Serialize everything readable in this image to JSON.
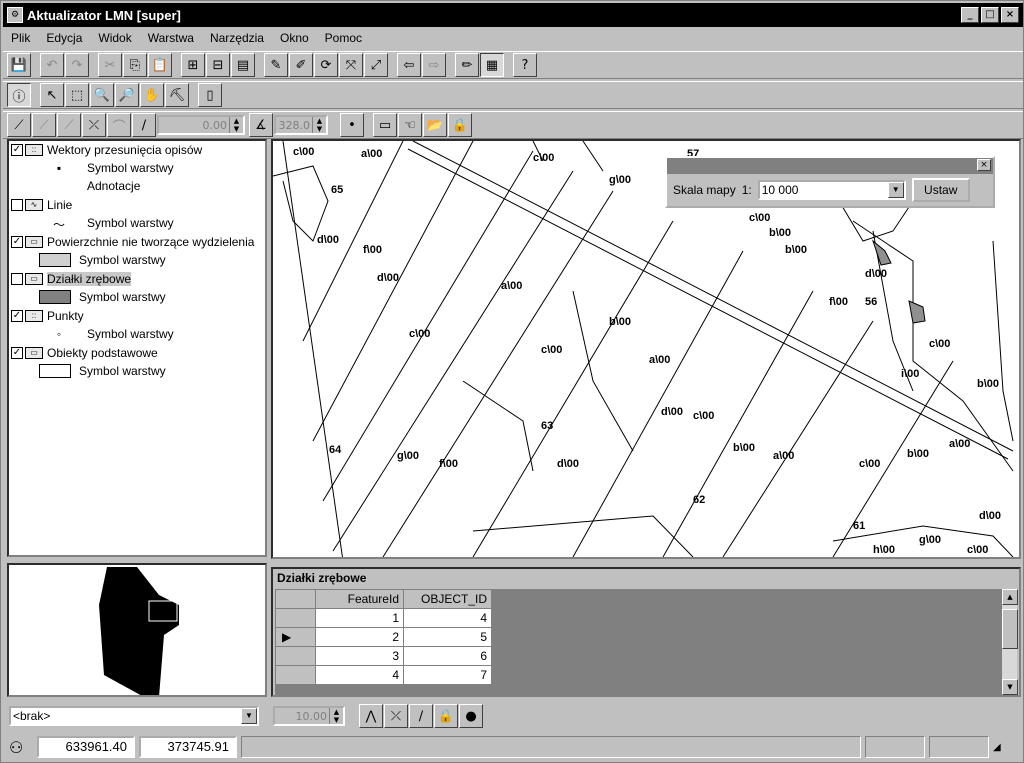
{
  "window": {
    "title": "Aktualizator LMN [super]",
    "minimize": "_",
    "maximize": "□",
    "close": "×"
  },
  "menu": [
    "Plik",
    "Edycja",
    "Widok",
    "Warstwa",
    "Narzędzia",
    "Okno",
    "Pomoc"
  ],
  "toolbar3": {
    "angle_value": "0.00",
    "length_value": "328.0"
  },
  "legend": {
    "layers": [
      {
        "name": "Wektory przesunięcia opisów",
        "checked": true,
        "sub": [
          "Symbol warstwy",
          "Adnotacje"
        ]
      },
      {
        "name": "Linie",
        "checked": false,
        "sub": [
          "Symbol warstwy"
        ]
      },
      {
        "name": "Powierzchnie nie tworzące wydzielenia",
        "checked": true,
        "sub": [
          "Symbol warstwy"
        ]
      },
      {
        "name": "Działki zrębowe",
        "checked": false,
        "sub": [
          "Symbol warstwy"
        ]
      },
      {
        "name": "Punkty",
        "checked": true,
        "sub": [
          "Symbol warstwy"
        ]
      },
      {
        "name": "Obiekty podstawowe",
        "checked": true,
        "sub": [
          "Symbol warstwy"
        ]
      }
    ]
  },
  "map": {
    "labels": [
      "c\\00",
      "a\\00",
      "c\\00",
      "g\\00",
      "57",
      "65",
      "d\\00",
      "f\\00",
      "d\\00",
      "a\\00",
      "c\\00",
      "b\\00",
      "b\\00",
      "c\\00",
      "d\\00",
      "56",
      "f\\00",
      "c\\00",
      "b\\00",
      "c\\00",
      "a\\00",
      "63",
      "d\\00",
      "c\\00",
      "i\\00",
      "64",
      "g\\00",
      "f\\00",
      "d\\00",
      "b\\00",
      "a\\00",
      "c\\00",
      "b\\00",
      "a\\00",
      "62",
      "61",
      "g\\00",
      "h\\00",
      "d\\00",
      "c\\00",
      "b\\00"
    ]
  },
  "scale_window": {
    "label": "Skala mapy",
    "prefix": "1:",
    "value": "10 000",
    "button": "Ustaw"
  },
  "table": {
    "title": "Działki zrębowe",
    "columns": [
      "FeatureId",
      "OBJECT_ID"
    ],
    "rows": [
      [
        "1",
        "4"
      ],
      [
        "2",
        "5"
      ],
      [
        "3",
        "6"
      ],
      [
        "4",
        "7"
      ]
    ]
  },
  "bottom": {
    "combo_value": "<brak>",
    "spin_value": "10.00"
  },
  "status": {
    "x": "633961.40",
    "y": "373745.91"
  }
}
